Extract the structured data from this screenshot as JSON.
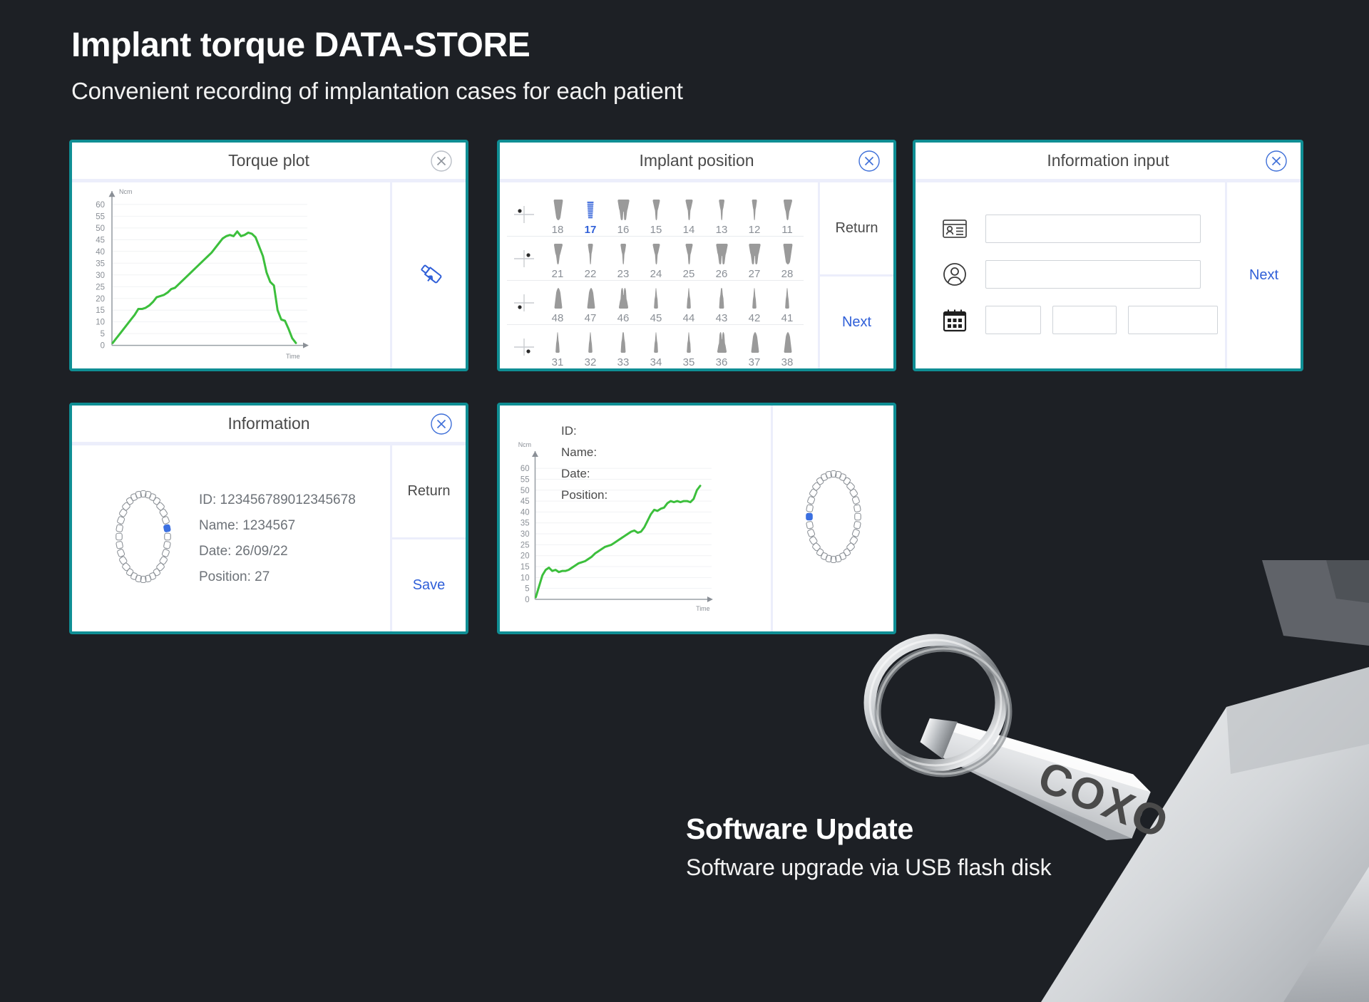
{
  "theme": {
    "background": "#1d2025",
    "card_border": "#0f8e94",
    "accent_blue": "#2f5fd8",
    "chart_green": "#3cbf3c",
    "divider": "#eceefb",
    "muted_text": "#8a8f96"
  },
  "headline": {
    "title": "Implant torque DATA-STORE",
    "subtitle": "Convenient recording of implantation cases for each patient"
  },
  "cards": {
    "torque_plot": {
      "title": "Torque plot",
      "close_icon": "close-circle-icon",
      "side_icon": "usb-upload-icon"
    },
    "implant_position": {
      "title": "Implant position",
      "close_icon": "close-circle-icon",
      "return_label": "Return",
      "next_label": "Next",
      "selected_position": "17",
      "rows": [
        {
          "marker": "upper-right-quadrant-marker",
          "cells": [
            {
              "num": "18",
              "tooth": "molar-two-root"
            },
            {
              "num": "17",
              "tooth": "implant-screw"
            },
            {
              "num": "16",
              "tooth": "molar-split-root"
            },
            {
              "num": "15",
              "tooth": "premolar-single-root"
            },
            {
              "num": "14",
              "tooth": "premolar-single-root"
            },
            {
              "num": "13",
              "tooth": "canine-single-root"
            },
            {
              "num": "12",
              "tooth": "incisor-single-root"
            },
            {
              "num": "11",
              "tooth": "incisor-wide-root"
            }
          ]
        },
        {
          "marker": "upper-left-quadrant-marker",
          "cells": [
            {
              "num": "21",
              "tooth": "incisor-wide-root"
            },
            {
              "num": "22",
              "tooth": "incisor-single-root"
            },
            {
              "num": "23",
              "tooth": "canine-single-root"
            },
            {
              "num": "24",
              "tooth": "premolar-single-root"
            },
            {
              "num": "25",
              "tooth": "premolar-single-root"
            },
            {
              "num": "26",
              "tooth": "molar-split-root"
            },
            {
              "num": "27",
              "tooth": "molar-split-root"
            },
            {
              "num": "28",
              "tooth": "molar-two-root"
            }
          ]
        },
        {
          "marker": "lower-right-quadrant-marker",
          "cells": [
            {
              "num": "48",
              "tooth": "lower-molar-two-root"
            },
            {
              "num": "47",
              "tooth": "lower-molar-two-root"
            },
            {
              "num": "46",
              "tooth": "lower-molar-split-root"
            },
            {
              "num": "45",
              "tooth": "lower-premolar"
            },
            {
              "num": "44",
              "tooth": "lower-premolar"
            },
            {
              "num": "43",
              "tooth": "lower-canine"
            },
            {
              "num": "42",
              "tooth": "lower-incisor"
            },
            {
              "num": "41",
              "tooth": "lower-incisor"
            }
          ]
        },
        {
          "marker": "lower-left-quadrant-marker",
          "cells": [
            {
              "num": "31",
              "tooth": "lower-incisor"
            },
            {
              "num": "32",
              "tooth": "lower-incisor"
            },
            {
              "num": "33",
              "tooth": "lower-canine"
            },
            {
              "num": "34",
              "tooth": "lower-premolar"
            },
            {
              "num": "35",
              "tooth": "lower-premolar"
            },
            {
              "num": "36",
              "tooth": "lower-molar-split-root"
            },
            {
              "num": "37",
              "tooth": "lower-molar-two-root"
            },
            {
              "num": "38",
              "tooth": "lower-molar-two-root"
            }
          ]
        }
      ]
    },
    "information_input": {
      "title": "Information input",
      "close_icon": "close-circle-icon",
      "next_label": "Next",
      "fields": [
        {
          "icon": "id-card-icon",
          "value": "",
          "placeholder": ""
        },
        {
          "icon": "user-circle-icon",
          "value": "",
          "placeholder": ""
        }
      ],
      "date_row": {
        "icon": "calendar-icon",
        "day": {
          "value": "",
          "placeholder": ""
        },
        "month": {
          "value": "",
          "placeholder": ""
        },
        "year": {
          "value": "",
          "placeholder": ""
        }
      }
    },
    "information": {
      "title": "Information",
      "close_icon": "close-circle-icon",
      "return_label": "Return",
      "save_label": "Save",
      "chart_icon": "dental-arch-icon",
      "details": [
        "ID: 123456789012345678",
        "Name: 1234567",
        "Date: 26/09/22",
        "Position: 27"
      ]
    },
    "record_detail": {
      "labels": [
        "ID:",
        "Name:",
        "Date:",
        "Position:"
      ],
      "chart_icon": "dental-arch-icon"
    }
  },
  "software_update": {
    "title": "Software Update",
    "subtitle": "Software upgrade via USB flash disk",
    "device_brand": "COXO"
  },
  "chart_data": [
    {
      "id": "torque_plot",
      "type": "line",
      "title": "Torque plot",
      "xlabel": "Time",
      "ylabel": "Ncm",
      "ylim": [
        0,
        62
      ],
      "yticks": [
        0,
        5,
        10,
        15,
        20,
        25,
        30,
        35,
        40,
        45,
        50,
        55,
        60
      ],
      "grid": true,
      "legend": "none",
      "series": [
        {
          "name": "Torque",
          "color": "#3cbf3c",
          "x": [
            0,
            2,
            4,
            6,
            8,
            10,
            12,
            14,
            16,
            18,
            20,
            22,
            24,
            26,
            28,
            30,
            32,
            34,
            36,
            38,
            40,
            42,
            44,
            46,
            48,
            50,
            52,
            54,
            56,
            58,
            60,
            62,
            64,
            66,
            68,
            70,
            72,
            74,
            76,
            78,
            80,
            82,
            84,
            86,
            88,
            90,
            92,
            94,
            96,
            98,
            100
          ],
          "y": [
            1,
            3,
            5,
            7,
            9,
            11,
            13,
            15.5,
            15.5,
            16,
            17,
            18.5,
            20.5,
            21,
            21.5,
            22.5,
            24,
            24.5,
            26,
            27.5,
            29,
            30.5,
            32,
            33.5,
            35,
            36.5,
            38,
            39.5,
            41.5,
            43.5,
            45.5,
            46.5,
            47,
            46.5,
            48.5,
            46.5,
            47,
            48,
            47.5,
            46,
            42,
            38,
            31,
            27,
            25.5,
            15,
            11,
            10.5,
            7,
            3,
            1
          ]
        }
      ]
    },
    {
      "id": "record_detail_plot",
      "type": "line",
      "title": "",
      "xlabel": "Time",
      "ylabel": "Ncm",
      "ylim": [
        0,
        62
      ],
      "yticks": [
        0,
        5,
        10,
        15,
        20,
        25,
        30,
        35,
        40,
        45,
        50,
        55,
        60
      ],
      "grid": true,
      "legend": "none",
      "series": [
        {
          "name": "Torque",
          "color": "#26a626",
          "x": [
            0,
            2,
            4,
            6,
            8,
            10,
            12,
            14,
            16,
            18,
            20,
            22,
            24,
            26,
            28,
            30,
            32,
            34,
            36,
            38,
            40,
            42,
            44,
            46,
            48,
            50,
            52,
            54,
            56,
            58,
            60,
            62,
            64,
            66,
            68,
            70,
            72,
            74,
            76,
            78,
            80,
            82,
            84,
            86,
            88,
            90,
            92,
            94,
            96,
            98,
            100
          ],
          "y": [
            1,
            6,
            11,
            13.5,
            14.5,
            13,
            13.5,
            12.5,
            13,
            13,
            13.5,
            14.5,
            15.5,
            16.5,
            17,
            17.5,
            18.5,
            19.5,
            21,
            22,
            23,
            24,
            24.5,
            25,
            26,
            27,
            28,
            29,
            30,
            31,
            31.5,
            30.5,
            31,
            33,
            36,
            39,
            41,
            40.5,
            41.5,
            42,
            44,
            45,
            44.5,
            45,
            44.5,
            45,
            45,
            44.5,
            46,
            50,
            52
          ]
        }
      ]
    }
  ]
}
